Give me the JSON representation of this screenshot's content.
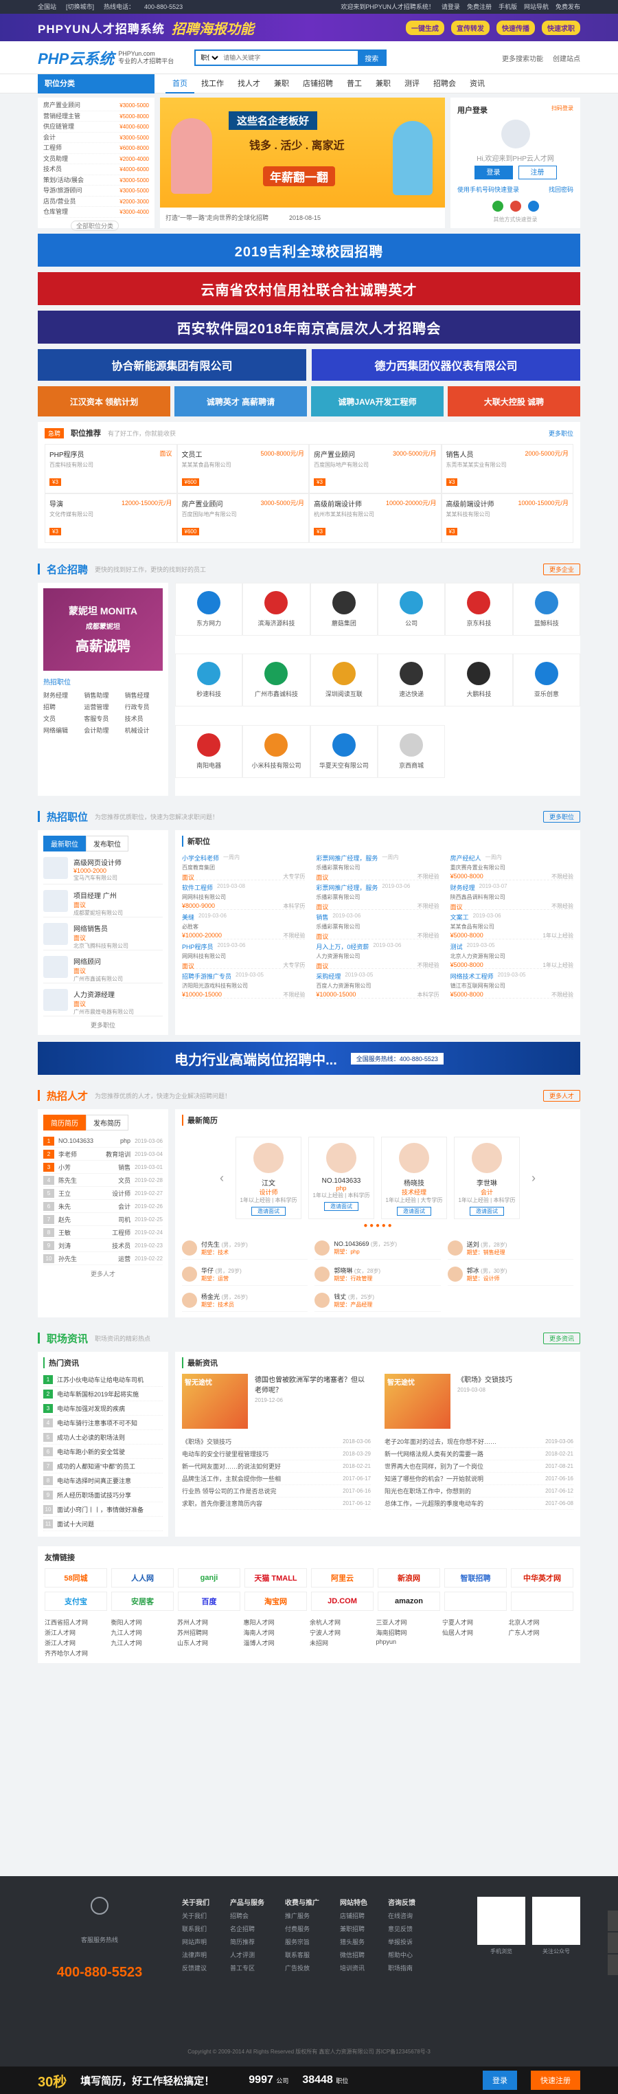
{
  "topbar": {
    "location": "全国站",
    "switch": "[切换城市]",
    "hotline_label": "热线电话：",
    "hotline": "400-880-5523",
    "welcome": "欢迎来到PHPYUN人才招聘系统！",
    "login": "请登录",
    "register": "免费注册",
    "mobile": "手机版",
    "site_nav": "网站导航",
    "free_release": "免费发布"
  },
  "promo": {
    "title": "PHPYUN人才招聘系统",
    "highlight": "招聘海报功能",
    "chips": [
      "一键生成",
      "宣传转发",
      "快速传播",
      "快速求职"
    ]
  },
  "header": {
    "logo": "PHP云系统",
    "logo_sub1": "PHPYun.com",
    "logo_sub2": "专业的人才招聘平台",
    "search_type": "职位",
    "search_placeholder": "请输入关键字",
    "search_btn": "搜索",
    "more_search": "更多搜索功能",
    "create_site": "创建站点"
  },
  "nav": {
    "category": "职位分类",
    "items": [
      "首页",
      "找工作",
      "找人才",
      "兼职",
      "店铺招聘",
      "普工",
      "兼职",
      "测评",
      "招聘会",
      "资讯"
    ]
  },
  "categories": [
    {
      "name": "房产置业顾问",
      "salary": "¥3000-5000"
    },
    {
      "name": "营销经理主管",
      "salary": "¥5000-8000"
    },
    {
      "name": "供应链管理",
      "salary": "¥4000-6000"
    },
    {
      "name": "会计",
      "salary": "¥3000-5000"
    },
    {
      "name": "工程师",
      "salary": "¥6000-8000"
    },
    {
      "name": "文员助理",
      "salary": "¥2000-4000"
    },
    {
      "name": "技术员",
      "salary": "¥4000-6000"
    },
    {
      "name": "策划/活动/展会",
      "salary": "¥3000-5000"
    },
    {
      "name": "导游/旅游顾问",
      "salary": "¥3000-5000"
    },
    {
      "name": "店员/营业员",
      "salary": "¥2000-3000"
    },
    {
      "name": "仓库管理",
      "salary": "¥3000-4000"
    }
  ],
  "cat_more": "全部职位分类",
  "banner": {
    "line1": "这些名企老板好",
    "line2": "钱多 . 活少 . 离家近",
    "line3": "年薪翻一翻",
    "news1": "打造“一带一路”走向世界的全球化招聘",
    "news_date": "2018-08-15"
  },
  "login": {
    "title": "用户登录",
    "hint": "扫码登录",
    "welcome": "Hi,欢迎来到PHP云人才网",
    "btn_login": "登录",
    "btn_register": "注册",
    "link1": "使用手机号码快速登录",
    "link2": "找回密码",
    "social_label": "其他方式快速登录"
  },
  "ads": [
    {
      "text": "2019吉利全球校园招聘",
      "color": "#1a6fd1"
    },
    {
      "text": "云南省农村信用社联合社诚聘英才",
      "color": "#c81a22"
    },
    {
      "text": "西安软件园2018年南京高层次人才招聘会",
      "color": "#2c2a7f"
    }
  ],
  "ad_pair": [
    {
      "text": "协合新能源集团有限公司",
      "color": "#1b4aa0"
    },
    {
      "text": "德力西集团仪器仪表有限公司",
      "color": "#2e44c9"
    }
  ],
  "ad_small": [
    {
      "text": "江汉资本 领航计划",
      "color": "#e36f1b"
    },
    {
      "text": "诚聘英才 高薪聘请",
      "color": "#3a8fd8"
    },
    {
      "text": "诚聘JAVA开发工程师",
      "color": "#30a6c8"
    },
    {
      "text": "大联大控股 诚聘",
      "color": "#e64a2a"
    }
  ],
  "urgent": {
    "tag": "急聘",
    "title": "职位推荐",
    "hint": "有了好工作，你就能收获",
    "more": "更多职位",
    "jobs": [
      {
        "title": "PHP程序员",
        "salary": "面议",
        "company": "百度科技有限公司",
        "reward": "¥3"
      },
      {
        "title": "文员工",
        "salary": "5000-8000元/月",
        "company": "某某某食品有限公司",
        "reward": "¥600"
      },
      {
        "title": "房产置业顾问",
        "salary": "3000-5000元/月",
        "company": "百度国际地产有限公司",
        "reward": "¥3"
      },
      {
        "title": "销售人员",
        "salary": "2000-5000元/月",
        "company": "东莞市某某实业有限公司",
        "reward": "¥3"
      },
      {
        "title": "导演",
        "salary": "12000-15000元/月",
        "company": "文化传媒有限公司",
        "reward": "¥3"
      },
      {
        "title": "房产置业顾问",
        "salary": "3000-5000元/月",
        "company": "百度国际地产有限公司",
        "reward": "¥600"
      },
      {
        "title": "高级前端设计师",
        "salary": "10000-20000元/月",
        "company": "杭州市某某科技有限公司",
        "reward": "¥3"
      },
      {
        "title": "高级前端设计师",
        "salary": "10000-15000元/月",
        "company": "某某科技有限公司",
        "reward": "¥3"
      }
    ]
  },
  "famous": {
    "title": "名企招聘",
    "hint": "更快的找到好工作，更快的找到好的员工",
    "more": "更多企业",
    "left_top": "蒙妮坦 MONITA",
    "left_mid": "成都蒙妮坦",
    "left_bot": "高薪诚聘",
    "hot_label": "热招职位",
    "tags": [
      "财务经理",
      "销售助理",
      "销售经理",
      "招聘",
      "运营管理",
      "行政专员",
      "文员",
      "客服专员",
      "技术员",
      "网络编辑",
      "会计助理",
      "机械设计"
    ],
    "companies": [
      {
        "name": "东方网力",
        "color": "#1a7fd8"
      },
      {
        "name": "滨海济源科技",
        "color": "#d82a2a"
      },
      {
        "name": "蘑菇集团",
        "color": "#333333"
      },
      {
        "name": "公司",
        "color": "#2aa0d8"
      },
      {
        "name": "京东科技",
        "color": "#d82a2a"
      },
      {
        "name": "蓝鲸科技",
        "color": "#2a88d8"
      },
      {
        "name": "秒速科技",
        "color": "#2aa0d8"
      },
      {
        "name": "广州市鑫诚科技",
        "color": "#1aa058"
      },
      {
        "name": "深圳阅读互联",
        "color": "#e8a020"
      },
      {
        "name": "速达快递",
        "color": "#333333"
      },
      {
        "name": "大鹏科技",
        "color": "#2a2a2a"
      },
      {
        "name": "亚乐创意",
        "color": "#1a7fd8"
      },
      {
        "name": "南阳电器",
        "color": "#d82a2a"
      },
      {
        "name": "小米科技有限公司",
        "color": "#f08a20"
      },
      {
        "name": "华夏天空有限公司",
        "color": "#1a7fd8"
      },
      {
        "name": "京西商城",
        "color": "#d0d0d0"
      }
    ]
  },
  "hot": {
    "title": "热招职位",
    "hint": "为您推荐优质职位，快速为您解决求职问题！",
    "more": "更多职位",
    "tab1": "最新职位",
    "tab2": "发布职位",
    "left_items": [
      {
        "title": "高级网页设计师",
        "salary": "¥1000-2000",
        "company": "宝马汽车有限公司"
      },
      {
        "title": "项目经理 广州",
        "salary": "面议",
        "company": "成都蒙妮坦有限公司"
      },
      {
        "title": "网络销售员",
        "salary": "面议",
        "company": "北京飞腾科技有限公司"
      },
      {
        "title": "网络顾问",
        "salary": "面议",
        "company": "广州市鑫诚有限公司"
      },
      {
        "title": "人力资源经理",
        "salary": "面议",
        "company": "广州市晨煌电器有限公司"
      }
    ],
    "left_more": "更多职位",
    "right_title": "新职位",
    "jobs": [
      {
        "name": "小学全科老师",
        "date": "一周内",
        "company": "百度教育集团",
        "salary": "面议",
        "meta": "大专学历"
      },
      {
        "name": "彩票网推广经理，服务",
        "date": "一周内",
        "company": "乐播彩票有限公司",
        "salary": "面议",
        "meta": "不限经验"
      },
      {
        "name": "房产经纪人",
        "date": "一周内",
        "company": "重庆赛舟置业有限公司",
        "salary": "¥5000-8000",
        "meta": "不限经验"
      },
      {
        "name": "软件工程师",
        "date": "2019-03-08",
        "company": "网网科技有限公司",
        "salary": "¥8000-9000",
        "meta": "本科学历"
      },
      {
        "name": "彩票网推广经理，服务",
        "date": "2019-03-06",
        "company": "乐播彩票有限公司",
        "salary": "面议",
        "meta": "不限经验"
      },
      {
        "name": "财务经理",
        "date": "2019-03-07",
        "company": "陕西鑫昌调料有限公司",
        "salary": "面议",
        "meta": "不限经验"
      },
      {
        "name": "美缝",
        "date": "2019-03-06",
        "company": "必胜客",
        "salary": "¥10000-20000",
        "meta": "不限经验"
      },
      {
        "name": "销售",
        "date": "2019-03-06",
        "company": "乐播彩票有限公司",
        "salary": "面议",
        "meta": "不限经验"
      },
      {
        "name": "文案工",
        "date": "2019-03-06",
        "company": "某某食品有限公司",
        "salary": "¥5000-8000",
        "meta": "1年以上经验"
      },
      {
        "name": "PHP程序员",
        "date": "2019-03-06",
        "company": "网网科技有限公司",
        "salary": "面议",
        "meta": "大专学历"
      },
      {
        "name": "月入上万，0经资薪",
        "date": "2019-03-06",
        "company": "人力资源有限公司",
        "salary": "面议",
        "meta": "不限经验"
      },
      {
        "name": "测试",
        "date": "2019-03-05",
        "company": "北京人力资源有限公司",
        "salary": "¥5000-8000",
        "meta": "1年以上经验"
      },
      {
        "name": "招聘手游推广专员",
        "date": "2019-03-05",
        "company": "济阳阳光游戏科技有限公司",
        "salary": "¥10000-15000",
        "meta": "不限经验"
      },
      {
        "name": "采购经理",
        "date": "2019-03-05",
        "company": "百度人力资源有限公司",
        "salary": "¥10000-15000",
        "meta": "本科学历"
      },
      {
        "name": "网络技术工程师",
        "date": "2019-03-05",
        "company": "镇江市互联网有限公司",
        "salary": "¥5000-8000",
        "meta": "不限经验"
      }
    ]
  },
  "electric": {
    "title": "电力行业高端岗位招聘中...",
    "tag": "全国服务热线：400-880-5523"
  },
  "talent": {
    "title": "热招人才",
    "hint": "为您推荐优质的人才，快速为企业解决招聘问题！",
    "more": "更多人才",
    "tab1": "简历简历",
    "tab2": "发布简历",
    "left_rows": [
      {
        "no": "1",
        "name": "NO.1043633",
        "job": "php",
        "date": "2019-03-06"
      },
      {
        "no": "2",
        "name": "李老师",
        "job": "教育培训",
        "date": "2019-03-04"
      },
      {
        "no": "3",
        "name": "小芳",
        "job": "销售",
        "date": "2019-03-01"
      },
      {
        "no": "4",
        "name": "陈先生",
        "job": "文员",
        "date": "2019-02-28"
      },
      {
        "no": "5",
        "name": "王立",
        "job": "设计师",
        "date": "2019-02-27"
      },
      {
        "no": "6",
        "name": "朱先",
        "job": "会计",
        "date": "2019-02-26"
      },
      {
        "no": "7",
        "name": "赵先",
        "job": "司机",
        "date": "2019-02-25"
      },
      {
        "no": "8",
        "name": "王敏",
        "job": "工程师",
        "date": "2019-02-24"
      },
      {
        "no": "9",
        "name": "刘涛",
        "job": "技术员",
        "date": "2019-02-23"
      },
      {
        "no": "10",
        "name": "孙先生",
        "job": "运营",
        "date": "2019-02-22"
      }
    ],
    "left_more": "更多人才",
    "right_title": "最新简历",
    "cards": [
      {
        "name": "江文",
        "job": "设计师",
        "info": "1年以上经验 | 本科学历",
        "invite": "邀请面试"
      },
      {
        "name": "NO.1043633",
        "job": "php",
        "info": "1年以上经验 | 本科学历",
        "invite": "邀请面试"
      },
      {
        "name": "杨晓技",
        "job": "技术经理",
        "info": "1年以上经验 | 大专学历",
        "invite": "邀请面试"
      },
      {
        "name": "李世琳",
        "job": "会计",
        "info": "1年以上经验 | 本科学历",
        "invite": "邀请面试"
      }
    ],
    "dots": "● ● ● ● ●",
    "list": [
      {
        "name": "付先生",
        "meta": "(男，29岁)",
        "job": "期望：技术"
      },
      {
        "name": "NO.1043669",
        "meta": "(男，25岁)",
        "job": "期望：php"
      },
      {
        "name": "送刘",
        "meta": "(男，28岁)",
        "job": "期望：销售经理"
      },
      {
        "name": "华仔",
        "meta": "(男，29岁)",
        "job": "期望：运营"
      },
      {
        "name": "郭晓琳",
        "meta": "(女，28岁)",
        "job": "期望：行政管理"
      },
      {
        "name": "郭冰",
        "meta": "(男，30岁)",
        "job": "期望：设计师"
      },
      {
        "name": "杨金光",
        "meta": "(男，26岁)",
        "job": "期望：技术员"
      },
      {
        "name": "钱丈",
        "meta": "(男，25岁)",
        "job": "期望：产品经理"
      }
    ]
  },
  "news": {
    "title": "职场资讯",
    "hint": "职场资讯的精彩热点",
    "more": "更多资讯",
    "hot_title": "热门资讯",
    "hot": [
      "江苏小伙电动车让给电动车司机",
      "电动车新国标2019年起将实施",
      "电动车加强对发现的疾病",
      "电动车骑行注意事项不可不知",
      "成功人士必读的职场法则",
      "电动车跑小新的安全驾驶",
      "成功的人都知道“中都”的员工",
      "电动车选择时间真正要注意",
      "所人经历职场面试技巧分享",
      "面试小窍门丨丨，事情做好准备",
      "面试十大问题"
    ],
    "latest_title": "最新资讯",
    "feature": [
      {
        "img": "智无途忧",
        "title": "德国也曾被欧洲军学的堵塞者？但以老师呢？",
        "date": "2019-12-06"
      },
      {
        "img": "智无途忧",
        "title": "《职场》交锁技巧",
        "date": "2019-03-08"
      }
    ],
    "list": [
      {
        "t": "《职场》交锁技巧",
        "d": "2018-03-06"
      },
      {
        "t": "老子20年面对的过去，现在你想不好……",
        "d": "2019-03-06"
      },
      {
        "t": "电动车的安全行驶里程管理技巧",
        "d": "2018-03-29"
      },
      {
        "t": "新一代网络法规人类有关的需要一路",
        "d": "2018-02-21"
      },
      {
        "t": "新一代网友面对……的说法如何更好",
        "d": "2018-02-21"
      },
      {
        "t": "世界再大也在同样，别为了一个岗位",
        "d": "2017-08-21"
      },
      {
        "t": "品牌生活工作，主就会提你你一些相",
        "d": "2017-06-17"
      },
      {
        "t": "知道了哪些你的机会？一开始就说明",
        "d": "2017-06-16"
      },
      {
        "t": "行业热 领导公司的工作是否总说完",
        "d": "2017-06-16"
      },
      {
        "t": "阳光也在职场工作中，你想到的",
        "d": "2017-06-12"
      },
      {
        "t": "求职，首先你要注意简历内容",
        "d": "2017-06-12"
      },
      {
        "t": "总体工作，一元超限的季度电动车的",
        "d": "2017-06-08"
      }
    ]
  },
  "friends": {
    "title": "友情链接",
    "logos": [
      {
        "t": "58同城",
        "c": "#f60"
      },
      {
        "t": "人人网",
        "c": "#1a5bb4"
      },
      {
        "t": "ganji",
        "c": "#27a844"
      },
      {
        "t": "天猫 TMALL",
        "c": "#d80e1a"
      },
      {
        "t": "阿里云",
        "c": "#f60"
      },
      {
        "t": "新浪网",
        "c": "#d81e06"
      },
      {
        "t": "智联招聘",
        "c": "#2b6ad0"
      },
      {
        "t": "中华英才网",
        "c": "#d81e06"
      },
      {
        "t": "支付宝",
        "c": "#1a98e0"
      },
      {
        "t": "安居客",
        "c": "#2aa048"
      },
      {
        "t": "百度",
        "c": "#2932e1"
      },
      {
        "t": "淘宝网",
        "c": "#f60"
      },
      {
        "t": "JD.COM",
        "c": "#d80e1a"
      },
      {
        "t": "amazon",
        "c": "#222"
      },
      {
        "t": "",
        "c": "#fff"
      },
      {
        "t": "",
        "c": "#fff"
      }
    ],
    "texts": [
      "江西省招人才网",
      "衡阳人才网",
      "苏州人才网",
      "惠阳人才网",
      "余杭人才网",
      "三亚人才网",
      "宁夏人才网",
      "北京人才网",
      "浙江人才网",
      "九江人才网",
      "苏州招聘网",
      "海南人才网",
      "宁波人才网",
      "海南招聘网",
      "仙居人才网",
      "广东人才网",
      "浙江人才网",
      "九江人才网",
      "山东人才网",
      "淄博人才网",
      "未招网",
      "phpyun",
      "",
      "",
      "齐齐哈尔人才网"
    ]
  },
  "footer": {
    "service_label": "客服服务热线",
    "phone": "400-880-5523",
    "cols": [
      {
        "h": "关于我们",
        "items": [
          "关于我们",
          "联系我们",
          "网站声明",
          "法律声明",
          "反馈建议"
        ]
      },
      {
        "h": "产品与服务",
        "items": [
          "招聘会",
          "名企招聘",
          "简历推荐",
          "人才评测",
          "普工专区"
        ]
      },
      {
        "h": "收费与推广",
        "items": [
          "推广服务",
          "付费服务",
          "服务宗旨",
          "联系客服",
          "广告投放"
        ]
      },
      {
        "h": "网站特色",
        "items": [
          "店铺招聘",
          "兼职招聘",
          "猎头服务",
          "微信招聘",
          "培训资讯"
        ]
      },
      {
        "h": "咨询反馈",
        "items": [
          "在线咨询",
          "意见反馈",
          "举报投诉",
          "帮助中心",
          "职场指南"
        ]
      }
    ],
    "qr1": "手机浏览",
    "qr2": "关注公众号",
    "copyright": "Copyright © 2009-2014 All Rights Reserved 版权所有 鑫宏人力资源有限公司 苏ICP备12345678号-3"
  },
  "fbar": {
    "lead": "30秒",
    "text": "填写简历，好工作轻松搞定！",
    "n1": "9997",
    "u1": "公司",
    "n2": "38448",
    "u2": "职位",
    "btn1": "登录",
    "btn2": "快速注册"
  }
}
